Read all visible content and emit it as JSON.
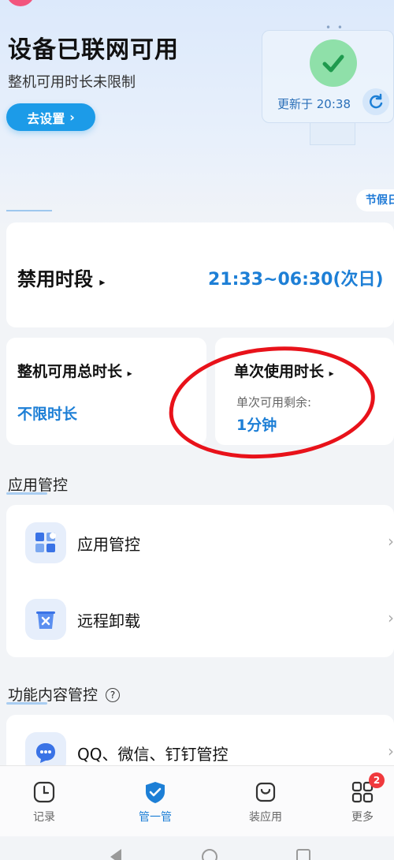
{
  "header": {
    "title": "设备已联网可用",
    "subtitle": "整机可用时长未限制",
    "go_settings_label": "去设置",
    "go_settings_chevron": "›",
    "update_text": "更新于 20:38",
    "holiday_tag": "节假日"
  },
  "ban_period": {
    "label": "禁用时段",
    "value": "21:33~06:30(次日)"
  },
  "total_time": {
    "label": "整机可用总时长",
    "value": "不限时长"
  },
  "single_time": {
    "label": "单次使用时长",
    "remain_label": "单次可用剩余:",
    "remain_value": "1分钟"
  },
  "app_section": {
    "title": "应用管控",
    "items": [
      {
        "label": "应用管控",
        "icon": "app-grid-icon"
      },
      {
        "label": "远程卸载",
        "icon": "trash-icon"
      }
    ]
  },
  "func_section": {
    "title": "功能内容管控",
    "items": [
      {
        "label": "QQ、微信、钉钉管控",
        "icon": "chat-icon"
      }
    ]
  },
  "bottom_nav": {
    "items": [
      {
        "label": "记录",
        "icon": "clock-icon"
      },
      {
        "label": "管一管",
        "icon": "shield-icon"
      },
      {
        "label": "装应用",
        "icon": "bag-icon"
      },
      {
        "label": "更多",
        "icon": "grid-icon",
        "badge": "2"
      }
    ]
  },
  "colors": {
    "accent": "#1d7fd6",
    "button": "#1c9be8",
    "annotation": "#e8121a"
  }
}
